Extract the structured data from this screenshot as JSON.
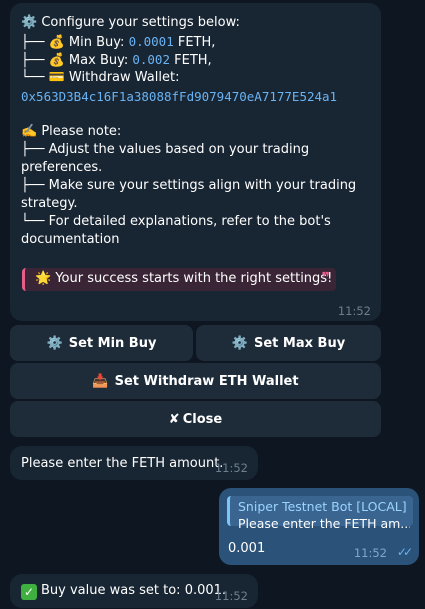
{
  "config": {
    "header": "⚙️ Configure your settings below:",
    "min_buy": {
      "prefix": "├── 💰 Min Buy: ",
      "value": "0.0001",
      "suffix": " FETH,"
    },
    "max_buy": {
      "prefix": "├── 💰 Max Buy: ",
      "value": "0.002",
      "suffix": " FETH,"
    },
    "withdraw": {
      "label": "└── 💳 Withdraw Wallet:"
    },
    "wallet_address": "0x563D3B4c16F1a38088fFd9079470eA7177E524a1",
    "note_header": "✍️ Please note:",
    "notes": [
      "├── Adjust the values based on your trading",
      "preferences.",
      "├── Make sure your settings align with your trading",
      "strategy.",
      "└── For detailed explanations, refer to the bot's",
      "documentation"
    ],
    "quote_text": "🌟 Your success starts with the right settings!",
    "quote_mark": "❞",
    "time": "11:52"
  },
  "keyboard": {
    "set_min_buy": "Set Min Buy",
    "set_max_buy": "Set Max Buy",
    "set_withdraw": "Set Withdraw ETH Wallet",
    "close": "Close",
    "gear_icon": "⚙️",
    "inbox_icon": "📥",
    "close_icon": "✘"
  },
  "messages": [
    {
      "text": "Please enter the FETH amount.",
      "time": "11:52"
    },
    {
      "reply_title": "Sniper Testnet Bot [LOCAL]",
      "reply_text": "Please enter the FETH am...",
      "text": "0.001",
      "time": "11:52",
      "status_icon": "✓✓"
    },
    {
      "icon": "✓",
      "text": "Buy value was set to: 0.001.",
      "time": "11:52"
    }
  ]
}
